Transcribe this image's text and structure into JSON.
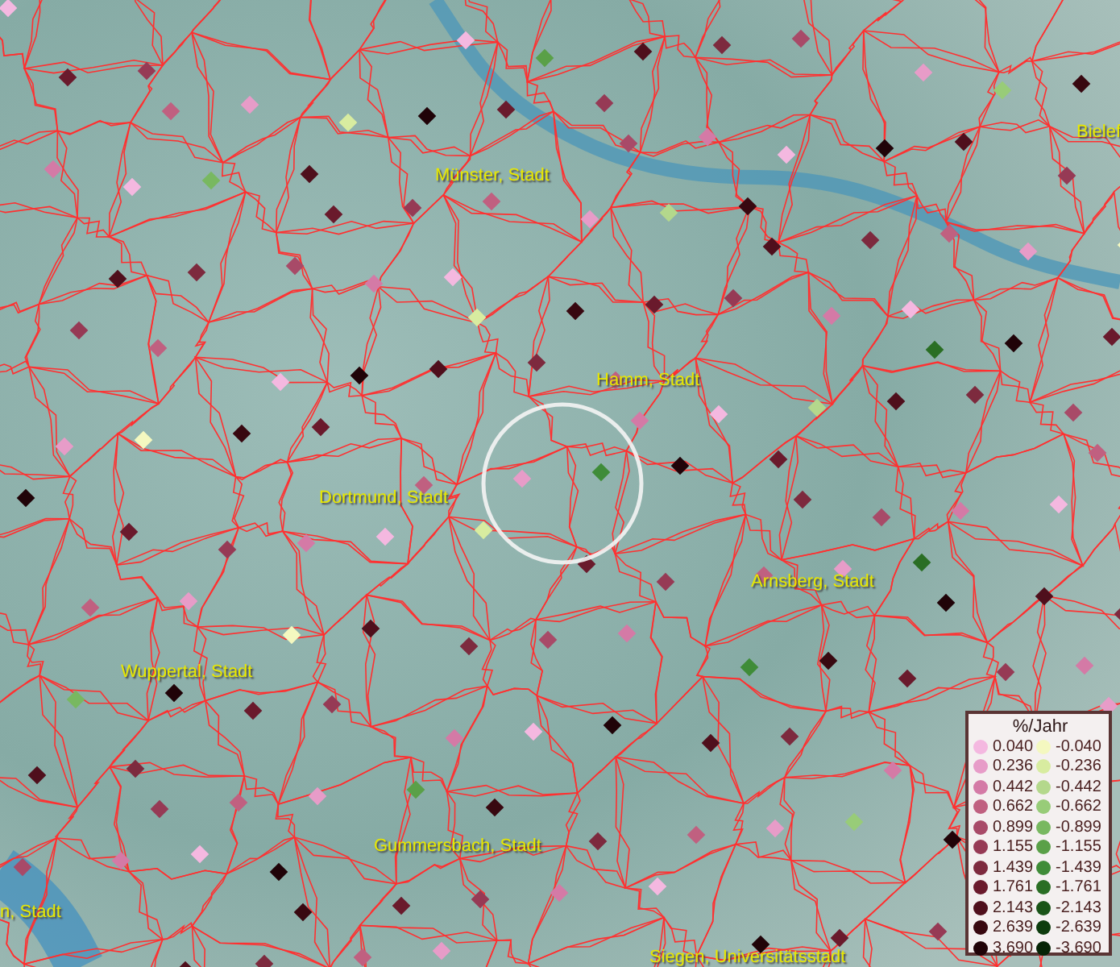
{
  "map": {
    "cities": [
      {
        "label": "Münster, Stadt"
      },
      {
        "label": "Bielef"
      },
      {
        "label": "Hamm, Stadt"
      },
      {
        "label": "Dortmund, Stadt"
      },
      {
        "label": "Arnsberg, Stadt"
      },
      {
        "label": "Wuppertal, Stadt"
      },
      {
        "label": "Gummersbach, Stadt"
      },
      {
        "label": "n, Stadt"
      },
      {
        "label": "Siegen, Universitätsstadt"
      }
    ]
  },
  "legend": {
    "title": "%/Jahr",
    "positive": [
      {
        "label": "0.040",
        "color": "#f4b8e0"
      },
      {
        "label": "0.236",
        "color": "#e79cc8"
      },
      {
        "label": "0.442",
        "color": "#d47aa6"
      },
      {
        "label": "0.662",
        "color": "#c06080"
      },
      {
        "label": "0.899",
        "color": "#a84a68"
      },
      {
        "label": "1.155",
        "color": "#963a55"
      },
      {
        "label": "1.439",
        "color": "#7d2a3e"
      },
      {
        "label": "1.761",
        "color": "#6a1a2c"
      },
      {
        "label": "2.143",
        "color": "#4f0f1c"
      },
      {
        "label": "2.639",
        "color": "#380810"
      },
      {
        "label": "3.690",
        "color": "#200308"
      }
    ],
    "negative": [
      {
        "label": "-0.040",
        "color": "#f4f8c0"
      },
      {
        "label": "-0.236",
        "color": "#d8eca0"
      },
      {
        "label": "-0.442",
        "color": "#b4d88c"
      },
      {
        "label": "-0.662",
        "color": "#98cc78"
      },
      {
        "label": "-0.899",
        "color": "#78b860"
      },
      {
        "label": "-1.155",
        "color": "#5aa048"
      },
      {
        "label": "-1.439",
        "color": "#3f8c38"
      },
      {
        "label": "-1.761",
        "color": "#2a6e24"
      },
      {
        "label": "-2.143",
        "color": "#1a5418"
      },
      {
        "label": "-2.639",
        "color": "#0e3c0e"
      },
      {
        "label": "-3.690",
        "color": "#062406"
      }
    ]
  }
}
